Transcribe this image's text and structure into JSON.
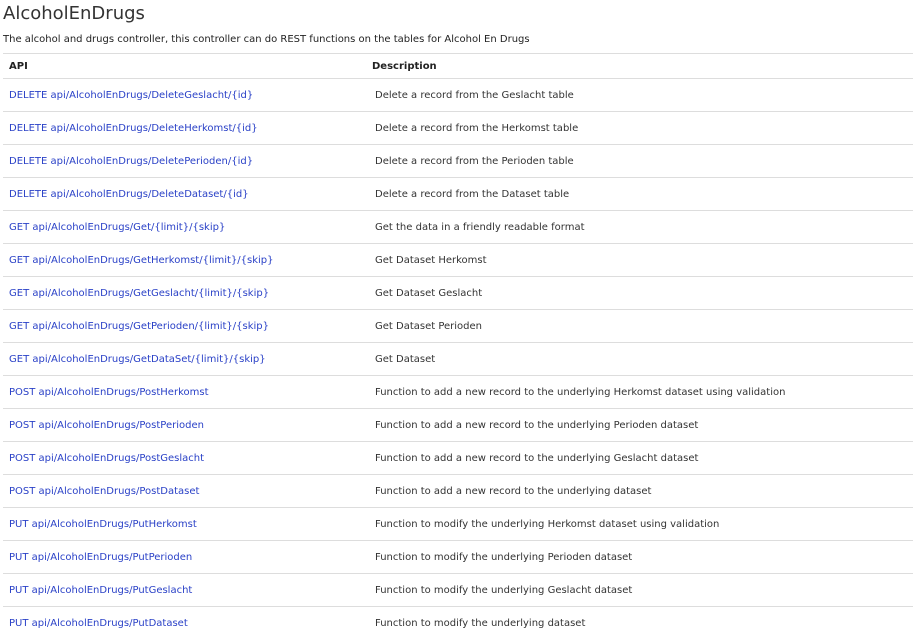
{
  "page": {
    "title": "AlcoholEnDrugs",
    "description": "The alcohol and drugs controller, this controller can do REST functions on the tables for Alcohol En Drugs"
  },
  "table": {
    "headers": {
      "api": "API",
      "description": "Description"
    },
    "rows": [
      {
        "api": "DELETE api/AlcoholEnDrugs/DeleteGeslacht/{id}",
        "description": "Delete a record from the Geslacht table"
      },
      {
        "api": "DELETE api/AlcoholEnDrugs/DeleteHerkomst/{id}",
        "description": "Delete a record from the Herkomst table"
      },
      {
        "api": "DELETE api/AlcoholEnDrugs/DeletePerioden/{id}",
        "description": "Delete a record from the Perioden table"
      },
      {
        "api": "DELETE api/AlcoholEnDrugs/DeleteDataset/{id}",
        "description": "Delete a record from the Dataset table"
      },
      {
        "api": "GET api/AlcoholEnDrugs/Get/{limit}/{skip}",
        "description": "Get the data in a friendly readable format"
      },
      {
        "api": "GET api/AlcoholEnDrugs/GetHerkomst/{limit}/{skip}",
        "description": "Get Dataset Herkomst"
      },
      {
        "api": "GET api/AlcoholEnDrugs/GetGeslacht/{limit}/{skip}",
        "description": "Get Dataset Geslacht"
      },
      {
        "api": "GET api/AlcoholEnDrugs/GetPerioden/{limit}/{skip}",
        "description": "Get Dataset Perioden"
      },
      {
        "api": "GET api/AlcoholEnDrugs/GetDataSet/{limit}/{skip}",
        "description": "Get Dataset"
      },
      {
        "api": "POST api/AlcoholEnDrugs/PostHerkomst",
        "description": "Function to add a new record to the underlying Herkomst dataset using validation"
      },
      {
        "api": "POST api/AlcoholEnDrugs/PostPerioden",
        "description": "Function to add a new record to the underlying Perioden dataset"
      },
      {
        "api": "POST api/AlcoholEnDrugs/PostGeslacht",
        "description": "Function to add a new record to the underlying Geslacht dataset"
      },
      {
        "api": "POST api/AlcoholEnDrugs/PostDataset",
        "description": "Function to add a new record to the underlying dataset"
      },
      {
        "api": "PUT api/AlcoholEnDrugs/PutHerkomst",
        "description": "Function to modify the underlying Herkomst dataset using validation"
      },
      {
        "api": "PUT api/AlcoholEnDrugs/PutPerioden",
        "description": "Function to modify the underlying Perioden dataset"
      },
      {
        "api": "PUT api/AlcoholEnDrugs/PutGeslacht",
        "description": "Function to modify the underlying Geslacht dataset"
      },
      {
        "api": "PUT api/AlcoholEnDrugs/PutDataset",
        "description": "Function to modify the underlying dataset"
      }
    ]
  },
  "colors": {
    "link": "#2a41c7",
    "text": "#222222",
    "border": "#dddddd"
  }
}
